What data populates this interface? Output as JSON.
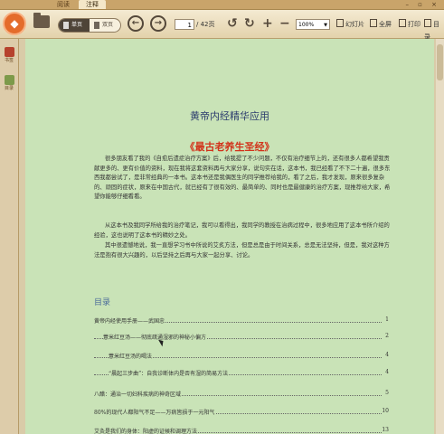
{
  "title_tabs": [
    {
      "label": "阅读",
      "active": false
    },
    {
      "label": "注释",
      "active": true
    }
  ],
  "window_controls": "– ▫ ×",
  "toolbar": {
    "single_page_label": "单页",
    "double_page_label": "双页",
    "page_current": "1",
    "page_total": "/ 42页",
    "zoom_value": "100%",
    "slideshow_label": "幻灯片",
    "fullscreen_label": "全屏",
    "print_label": "打印",
    "bookmark_label": "目录",
    "icons": [
      "open-folder-icon",
      "back-icon",
      "forward-icon",
      "rotate-left-icon",
      "rotate-right-icon",
      "zoom-in-icon",
      "zoom-out-icon",
      "slideshow-icon",
      "fullscreen-icon",
      "print-icon",
      "bookmark-icon"
    ]
  },
  "sidebar": {
    "items": [
      {
        "label": "书签",
        "icon": "bookmark-icon"
      },
      {
        "label": "目录",
        "icon": "toc-icon"
      }
    ]
  },
  "colors": {
    "page_background": "#c9e3b7",
    "title": "#2d3e6e",
    "book_title": "#d2331b",
    "toc_heading": "#496a9a"
  },
  "document": {
    "title": "黄帝内经精华应用",
    "book_title": "《最古老养生圣经》",
    "paragraphs": [
      "很多朋友看了我的《自愈后遗症治疗方案》后，给我提了不少问题，不仅有治疗细节上的，还有很多人都希望我贡献更多的、更有价值的资料，现在我将这套资料再与大家分享，说句实在话，这本书，我已经看了不下二十遍，很多东西我都尝试了，是非常经典的一本书。这本书还是我偶医生的同学推荐给我的，看了之后，我才发现，原来很多复杂的、顽固的症状，原来在中国古代，就已经有了很有效的、最简单的、同时也是最健康的治疗方案，现推荐给大家，希望你能够仔细看看。",
      "从这本书及我同学所给我的治疗笔记，我可以看得出，我同学的教授在治病过程中，很多地应用了这本书所介绍的经验，这也说明了这本书的精妙之处。",
      "其中很遗憾地说，我一直想学习书中所说的艾炙方法，但是总是由于时间关系，总是无法坚持，但是，我对这种方法是抱有很大兴趣的，以后坚持之后再与大家一起分享、讨论。"
    ],
    "toc_heading": "目录",
    "toc": [
      {
        "title": "黄帝内经使用手册——武国忠",
        "page": "1"
      },
      {
        "title": "薏米红豆汤——彻底疏通湿邪的神秘小偏方",
        "page": "2"
      },
      {
        "title": "薏米红豆汤的喝法",
        "page": "4"
      },
      {
        "title": "“晨起三步曲”：自我诊断体内是否有湿的简易方法",
        "page": "4"
      },
      {
        "title": "八醋：通治一切妇科疾病的神奇区域",
        "page": "5"
      },
      {
        "title": "80%的现代人都阳气不足——万病皆损于一元阳气",
        "page": "10"
      },
      {
        "title": "艾灸是我们的身体：阳虚的证候和调理方法",
        "page": "13"
      }
    ]
  }
}
